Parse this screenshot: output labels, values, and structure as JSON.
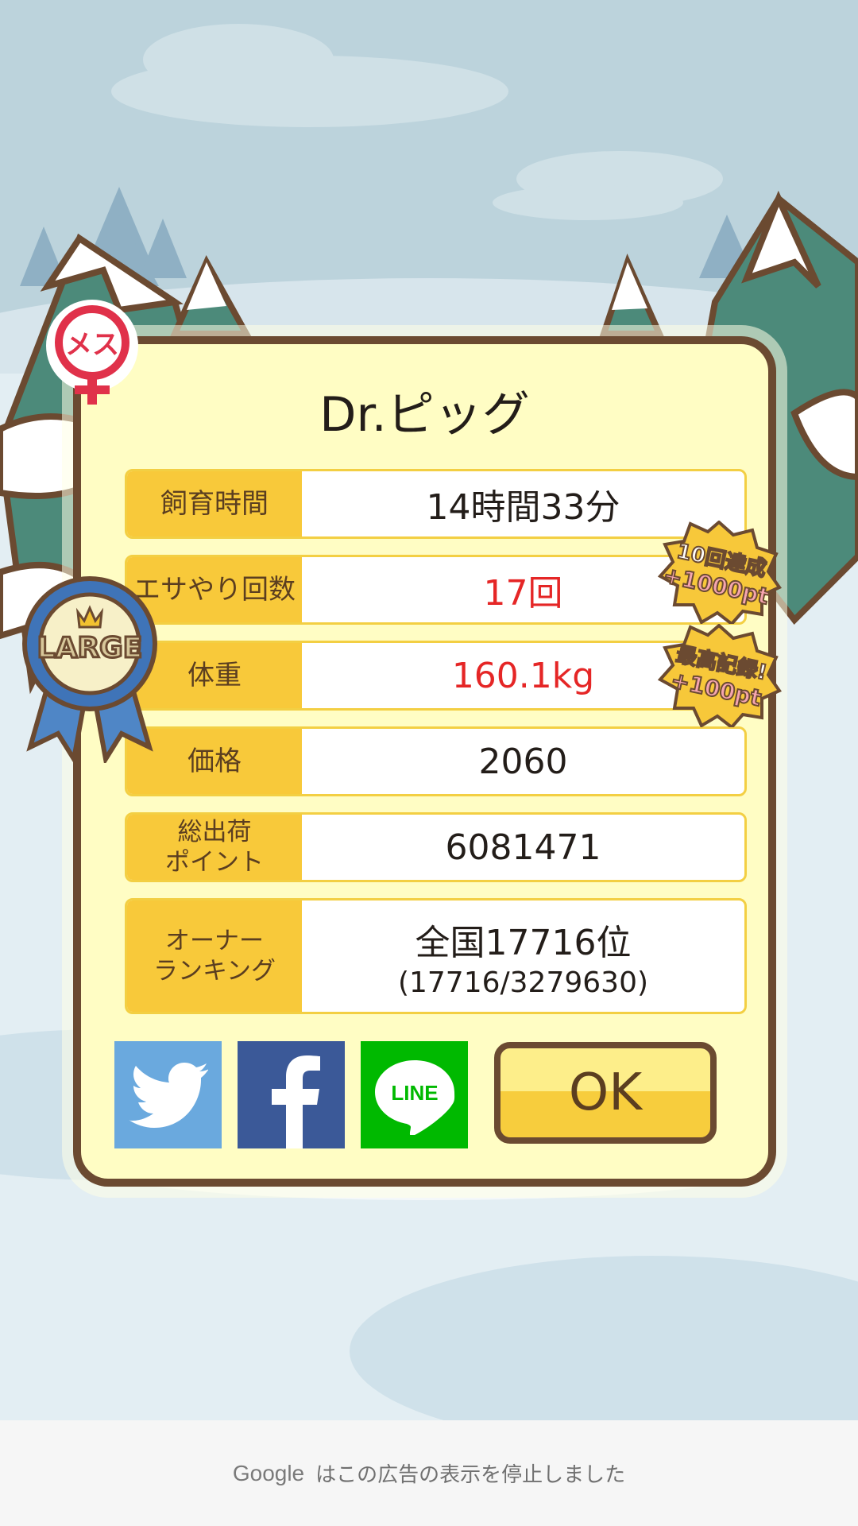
{
  "dialog": {
    "title": "Dr.ピッグ",
    "gender_badge": "メス",
    "size_ribbon": "LARGE",
    "stats": [
      {
        "label": "飼育時間",
        "value": "14時間33分",
        "highlight": false
      },
      {
        "label": "エサやり回数",
        "value": "17回",
        "highlight": true
      },
      {
        "label": "体重",
        "value": "160.1kg",
        "highlight": true
      },
      {
        "label": "価格",
        "value": "2060",
        "highlight": false
      },
      {
        "label": "総出荷\nポイント",
        "value": "6081471",
        "highlight": false
      },
      {
        "label": "オーナー\nランキング",
        "value": "全国17716位",
        "sub": "(17716/3279630)",
        "highlight": false
      }
    ],
    "achievements": [
      {
        "line1": "10回達成",
        "line2": "+1000pt"
      },
      {
        "line1": "最高記録!",
        "line2": "+100pt"
      }
    ],
    "share": {
      "twitter_icon": "twitter-icon",
      "facebook_icon": "facebook-icon",
      "line_icon": "line-icon",
      "line_label": "LINE"
    },
    "ok_label": "OK"
  },
  "ad_notice": {
    "brand": "Google",
    "text": "はこの広告の表示を停止しました"
  },
  "colors": {
    "card_bg": "#fffdc4",
    "card_border": "#6b4a31",
    "label_bg": "#f8c93a",
    "highlight_text": "#e52626",
    "twitter": "#6aa9de",
    "facebook": "#3b5998",
    "line": "#00b900"
  }
}
